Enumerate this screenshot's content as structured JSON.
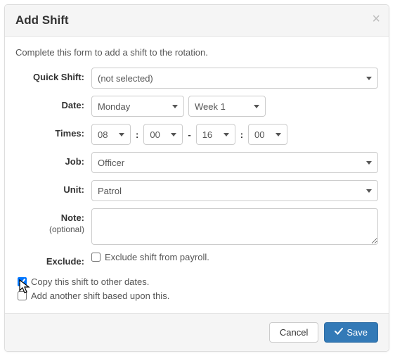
{
  "header": {
    "title": "Add Shift"
  },
  "intro": "Complete this form to add a shift to the rotation.",
  "labels": {
    "quick_shift": "Quick Shift:",
    "date": "Date:",
    "times": "Times:",
    "job": "Job:",
    "unit": "Unit:",
    "note": "Note:",
    "note_sub": "(optional)",
    "exclude": "Exclude:"
  },
  "fields": {
    "quick_shift": "(not selected)",
    "date_day": "Monday",
    "date_week": "Week 1",
    "time_start_h": "08",
    "time_start_m": "00",
    "time_end_h": "16",
    "time_end_m": "00",
    "job": "Officer",
    "unit": "Patrol",
    "note": ""
  },
  "checks": {
    "exclude": {
      "label": "Exclude shift from payroll.",
      "checked": false
    },
    "copy_dates": {
      "label": "Copy this shift to other dates.",
      "checked": true
    },
    "add_another": {
      "label": "Add another shift based upon this.",
      "checked": false
    }
  },
  "footer": {
    "cancel": "Cancel",
    "save": "Save"
  }
}
